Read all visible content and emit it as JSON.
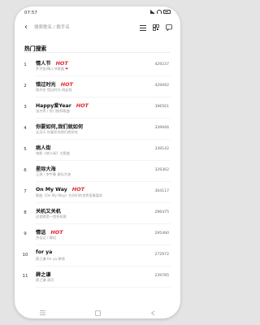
{
  "status_bar": {
    "time": "07:57"
  },
  "search": {
    "placeholder": "搜索歌名 / 歌手名"
  },
  "icons": {
    "back": "back-arrow-icon",
    "list": "list-icon",
    "qr": "qr-code-icon",
    "chat": "chat-icon"
  },
  "section_title": "热门搜索",
  "hot_label": "HOT",
  "items": [
    {
      "rank": "1",
      "title": "情人节",
      "artist": "罗大佑/情人节歌曲",
      "count": "429237",
      "hot": true,
      "heart": true
    },
    {
      "rank": "2",
      "title": "错过时光",
      "artist": "周杰伦 错过时光 网友版",
      "count": "429092",
      "hot": true,
      "heart": false
    },
    {
      "rank": "3",
      "title": "Happy爱Year",
      "artist": "张杰等 / 热门推荐歌曲",
      "count": "396561",
      "hot": true,
      "heart": false
    },
    {
      "rank": "4",
      "title": "你要如何,我们就如何",
      "artist": "五月天 你要如何我们就如何",
      "count": "339946",
      "hot": false,
      "heart": false
    },
    {
      "rank": "5",
      "title": "病人街",
      "artist": "电影《病人街》主题曲",
      "count": "339142",
      "hot": false,
      "heart": false
    },
    {
      "rank": "6",
      "title": "星际大海",
      "artist": "王源 / 李宇春 星际大海",
      "count": "329362",
      "hot": false,
      "heart": false
    },
    {
      "rank": "7",
      "title": "On My Way",
      "artist": "歌曲《On My Way》在你们的世界里最喜欢",
      "count": "304117",
      "hot": true,
      "heart": false
    },
    {
      "rank": "8",
      "title": "关机又关机",
      "artist": "这首歌是一首关机歌",
      "count": "296475",
      "hot": false,
      "heart": false
    },
    {
      "rank": "9",
      "title": "情话",
      "artist": "余佳运 / 情话",
      "count": "295490",
      "hot": true,
      "heart": false
    },
    {
      "rank": "10",
      "title": "for ya",
      "artist": "薛之谦 for ya 原唱",
      "count": "272972",
      "hot": false,
      "heart": false
    },
    {
      "rank": "11",
      "title": "薛之谦",
      "artist": "薛之谦 演员",
      "count": "239785",
      "hot": false,
      "heart": false
    }
  ],
  "colors": {
    "hot": "#e0252b",
    "background": "#e4e4e4",
    "card": "#ffffff"
  }
}
